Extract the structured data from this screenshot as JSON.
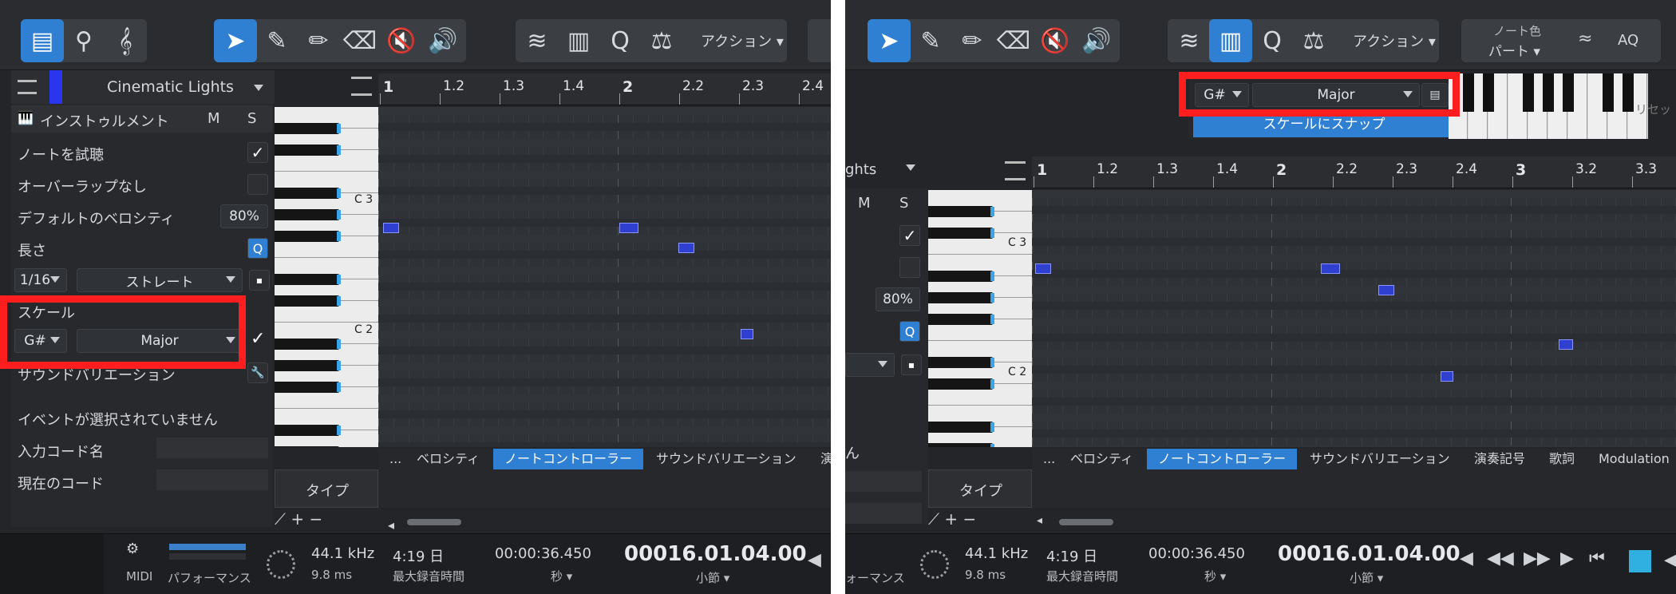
{
  "left": {
    "toolbar": {
      "action_label": "アクション"
    },
    "track": {
      "name": "Cinematic Lights"
    },
    "inspector": {
      "instrument_label": "インストゥルメント",
      "m_label": "M",
      "s_label": "S",
      "audition_label": "ノートを試聴",
      "overlap_label": "オーバーラップなし",
      "velocity_label": "デフォルトのベロシティ",
      "velocity_value": "80%",
      "length_label": "長さ",
      "q_label": "Q",
      "grid_value": "1/16",
      "grid_mode": "ストレート",
      "scale_label": "スケール",
      "scale_root": "G#",
      "scale_type": "Major",
      "sound_variation_label": "サウンドバリエーション",
      "no_event_label": "イベントが選択されていません",
      "chord_input_label": "入力コード名",
      "current_chord_label": "現在のコード"
    },
    "ruler": [
      "1",
      "1.2",
      "1.3",
      "1.4",
      "2",
      "2.2",
      "2.3",
      "2.4"
    ],
    "keyboard_labels": {
      "c3": "C 3",
      "c2": "C 2"
    },
    "tabs": [
      "...",
      "ベロシティ",
      "ノートコントローラー",
      "サウンドバリエーション",
      "演奏"
    ],
    "active_tab": "ノートコントローラー",
    "type_label": "タイプ",
    "status": {
      "midi_label": "MIDI",
      "performance_label": "パフォーマンス",
      "sample_rate": "44.1 kHz",
      "latency": "9.8 ms",
      "record_days": "4:19 日",
      "record_label": "最大録音時間",
      "time_value": "00:00:36.450",
      "time_unit": "秒",
      "bars_value": "00016.01.04.00",
      "bars_unit": "小節"
    }
  },
  "right": {
    "toolbar": {
      "action_label": "アクション",
      "note_color_label": "ノート色",
      "note_color_value": "パート",
      "aq_label": "AQ"
    },
    "scale_bar": {
      "root": "G#",
      "type": "Major",
      "snap_label": "スケールにスナップ",
      "reset_label": "リセッ"
    },
    "track_fragment": "ghts",
    "m_label": "M",
    "s_label": "S",
    "velocity_value": "80%",
    "q_label": "Q",
    "ruler": [
      "1",
      "1.2",
      "1.3",
      "1.4",
      "2",
      "2.2",
      "2.3",
      "2.4",
      "3",
      "3.2",
      "3.3"
    ],
    "keyboard_labels": {
      "c3": "C 3",
      "c2": "C 2"
    },
    "tabs": [
      "...",
      "ベロシティ",
      "ノートコントローラー",
      "サウンドバリエーション",
      "演奏記号",
      "歌詞",
      "Modulation"
    ],
    "active_tab": "ノートコントローラー",
    "type_label": "タイプ",
    "left_fragment": "ん",
    "status": {
      "performance_fragment": "ォーマンス",
      "sample_rate": "44.1 kHz",
      "latency": "9.8 ms",
      "record_days": "4:19 日",
      "record_label": "最大録音時間",
      "time_value": "00:00:36.450",
      "time_unit": "秒",
      "bars_value": "00016.01.04.00",
      "bars_unit": "小節"
    }
  },
  "colors": {
    "accent": "#2f7fd3",
    "highlight": "#ff1e1e",
    "note": "#2f3fd0"
  }
}
